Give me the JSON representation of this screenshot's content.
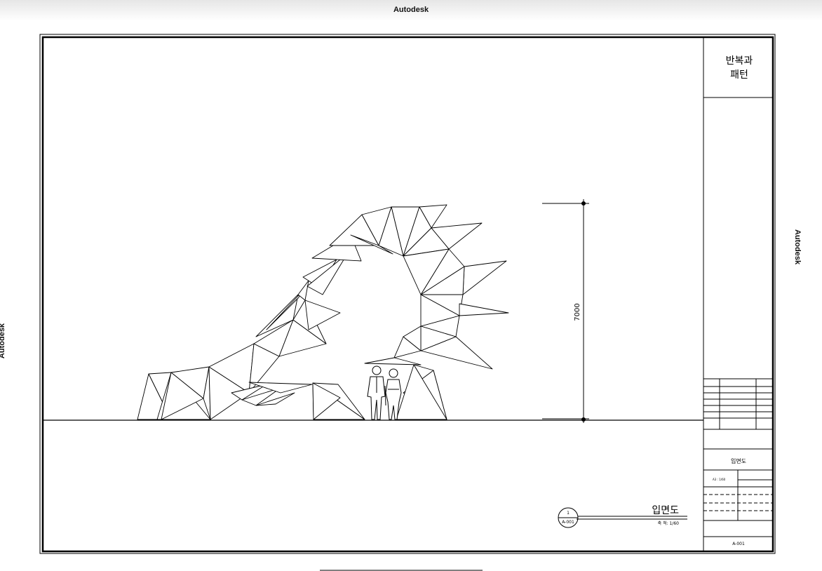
{
  "watermarks": {
    "top": "Autodesk",
    "left": "Autodesk",
    "right": "Autodesk"
  },
  "title_block": {
    "project_title_line1": "반복과",
    "project_title_line2": "패턴",
    "drawing_title": "입면도",
    "paper_scale": "A3 : 1/60",
    "sheet_number": "A-001"
  },
  "dimension": {
    "height_value": "7000"
  },
  "callout": {
    "detail_number": "1",
    "sheet_ref": "A-001",
    "title": "입면도",
    "scale_label": "축 척: 1/60"
  }
}
